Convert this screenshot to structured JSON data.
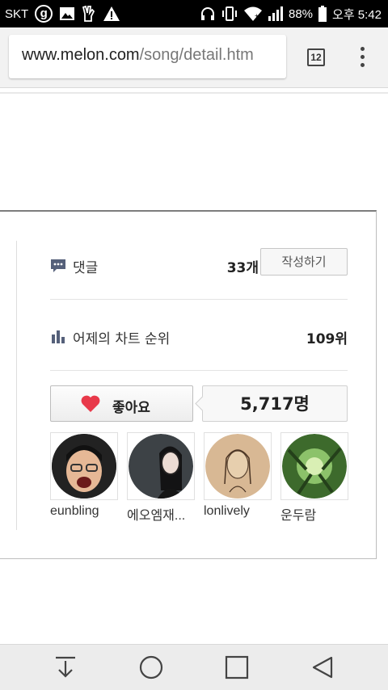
{
  "status_bar": {
    "carrier": "SKT",
    "g_icon_label": "g",
    "battery_percent": "88%",
    "time": "오후 5:42",
    "icons": [
      "g-circle-icon",
      "image-icon",
      "hand-icon",
      "warning-icon",
      "headphones-icon",
      "vibrate-icon",
      "wifi-icon",
      "signal-icon",
      "battery-icon"
    ]
  },
  "browser": {
    "url_domain": "www.melon.com",
    "url_path": "/song/detail.htm",
    "tab_count": "12",
    "menu_icon": "more-vert-icon"
  },
  "song_panel": {
    "comments": {
      "label": "댓글",
      "count": "33개",
      "write_button": "작성하기",
      "icon": "comment-icon"
    },
    "chart_rank": {
      "label": "어제의 차트 순위",
      "value": "109위",
      "icon": "bar-chart-icon"
    },
    "like": {
      "button_label": "좋아요",
      "count": "5,717명",
      "icon": "heart-icon",
      "heart_color": "#e8394a"
    },
    "fans": [
      {
        "name": "eunbling",
        "avatar": "avatar-icon"
      },
      {
        "name": "에오엠재...",
        "avatar": "avatar-icon"
      },
      {
        "name": "lonlively",
        "avatar": "avatar-icon"
      },
      {
        "name": "운두람",
        "avatar": "avatar-icon"
      }
    ]
  },
  "nav_bar": {
    "buttons": [
      "download-icon",
      "home-icon",
      "recents-icon",
      "back-icon"
    ]
  }
}
